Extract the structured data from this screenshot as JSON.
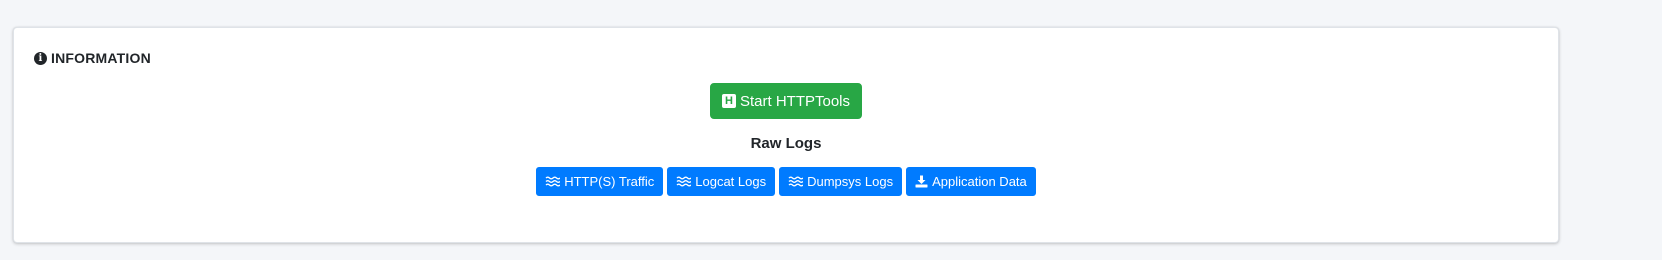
{
  "card": {
    "title": "INFORMATION",
    "title_icon": "info-circle-icon"
  },
  "start_button": {
    "label": "Start HTTPTools",
    "icon": "h-square-icon",
    "icon_letter": "H",
    "color": "#28a745"
  },
  "raw_logs": {
    "title": "Raw Logs",
    "buttons": [
      {
        "label": "HTTP(S) Traffic",
        "icon": "water-icon"
      },
      {
        "label": "Logcat Logs",
        "icon": "water-icon"
      },
      {
        "label": "Dumpsys Logs",
        "icon": "water-icon"
      },
      {
        "label": "Application Data",
        "icon": "download-icon"
      }
    ],
    "color": "#007bff"
  }
}
